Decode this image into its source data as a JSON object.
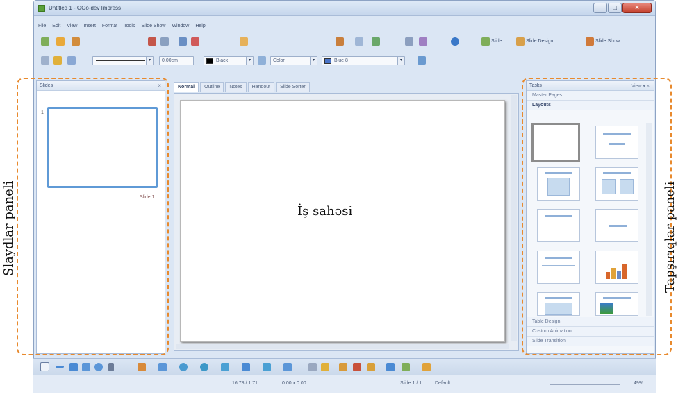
{
  "window": {
    "title": "Untitled 1 - OOo-dev Impress"
  },
  "menu": [
    "File",
    "Edit",
    "View",
    "Insert",
    "Format",
    "Tools",
    "Slide Show",
    "Window",
    "Help"
  ],
  "toolbar1": {
    "slide_label": "Slide",
    "slide_design_label": "Slide Design",
    "slide_show_label": "Slide Show"
  },
  "toolbar2": {
    "line_width": "0.00cm",
    "line_color": "Black",
    "area_style": "Color",
    "area_color": "Blue 8"
  },
  "slides_panel": {
    "title": "Slides",
    "slide_number": "1",
    "slide_name": "Slide 1"
  },
  "work_tabs": [
    "Normal",
    "Outline",
    "Notes",
    "Handout",
    "Slide Sorter"
  ],
  "tasks_panel": {
    "title": "Tasks",
    "view_label": "View",
    "sections_top": [
      "Master Pages",
      "Layouts"
    ],
    "sections_bottom": [
      "Table Design",
      "Custom Animation",
      "Slide Transition"
    ]
  },
  "status": {
    "position": "16.78 / 1.71",
    "size": "0.00 x 0.00",
    "slide_indicator": "Slide 1 / 1",
    "master": "Default",
    "zoom": "49%"
  },
  "annotations": {
    "left_panel": "Slaydlar paneli",
    "work_area": "İş sahəsi",
    "right_panel": "Tapşırıqlar paneli"
  },
  "colors": {
    "annotation_dash": "#e88a2e",
    "slide_selection": "#5f9ad6",
    "window_chrome": "#dbe6f4"
  }
}
